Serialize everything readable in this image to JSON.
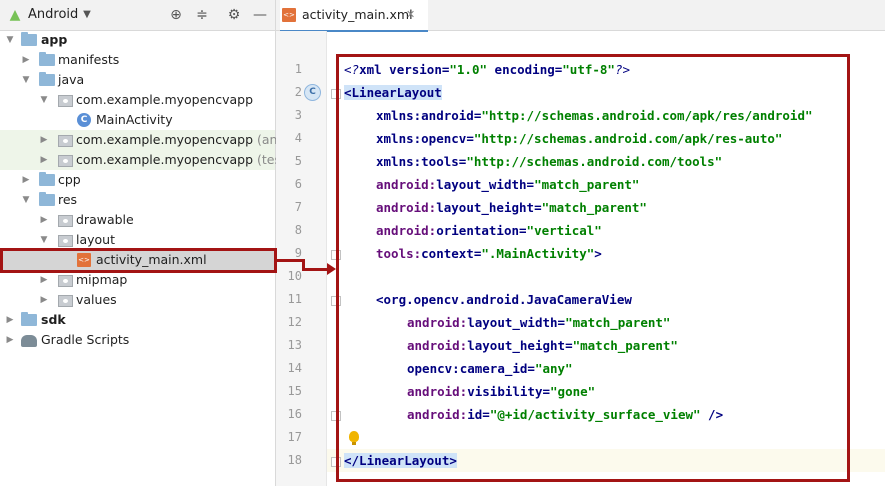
{
  "panel": {
    "title": "Android",
    "dropdown_icon": "chevron-down-icon",
    "toolbar_icons": [
      "target-icon",
      "collapse-icon",
      "gear-icon",
      "minimize-icon"
    ]
  },
  "tree": [
    {
      "label": "app",
      "suffix": ""
    },
    {
      "label": "manifests",
      "suffix": ""
    },
    {
      "label": "java",
      "suffix": ""
    },
    {
      "label": "com.example.myopencvapp",
      "suffix": ""
    },
    {
      "label": "MainActivity",
      "suffix": ""
    },
    {
      "label": "com.example.myopencvapp",
      "suffix": " (androic"
    },
    {
      "label": "com.example.myopencvapp",
      "suffix": " (test)"
    },
    {
      "label": "cpp",
      "suffix": ""
    },
    {
      "label": "res",
      "suffix": ""
    },
    {
      "label": "drawable",
      "suffix": ""
    },
    {
      "label": "layout",
      "suffix": ""
    },
    {
      "label": "activity_main.xml",
      "suffix": ""
    },
    {
      "label": "mipmap",
      "suffix": ""
    },
    {
      "label": "values",
      "suffix": ""
    },
    {
      "label": "sdk",
      "suffix": ""
    },
    {
      "label": "Gradle Scripts",
      "suffix": ""
    }
  ],
  "editor": {
    "tab_label": "activity_main.xml",
    "tab_close": "✕",
    "line_numbers": [
      "1",
      "2",
      "3",
      "4",
      "5",
      "6",
      "7",
      "8",
      "9",
      "10",
      "11",
      "12",
      "13",
      "14",
      "15",
      "16",
      "17",
      "18"
    ],
    "gutter_marker": "C",
    "lines": {
      "l1": {
        "open": "<?",
        "tagname": "xml",
        "a1": " version=",
        "v1": "\"1.0\"",
        "a2": " encoding=",
        "v2": "\"utf-8\"",
        "close": "?>"
      },
      "l2": {
        "text": "<LinearLayout"
      },
      "l3": {
        "ns": "xmlns:",
        "attr": "android",
        "eq": "=",
        "val": "\"http://schemas.android.com/apk/res/android\""
      },
      "l4": {
        "ns": "xmlns:",
        "attr": "opencv",
        "eq": "=",
        "val": "\"http://schemas.android.com/apk/res-auto\""
      },
      "l5": {
        "ns": "xmlns:",
        "attr": "tools",
        "eq": "=",
        "val": "\"http://schemas.android.com/tools\""
      },
      "l6": {
        "ns": "android:",
        "attr": "layout_width",
        "eq": "=",
        "val": "\"match_parent\""
      },
      "l7": {
        "ns": "android:",
        "attr": "layout_height",
        "eq": "=",
        "val": "\"match_parent\""
      },
      "l8": {
        "ns": "android:",
        "attr": "orientation",
        "eq": "=",
        "val": "\"vertical\""
      },
      "l9": {
        "ns": "tools:",
        "attr": "context",
        "eq": "=",
        "val": "\".MainActivity\"",
        "end": ">"
      },
      "l11": {
        "text": "<org.opencv.android.JavaCameraView"
      },
      "l12": {
        "ns": "android:",
        "attr": "layout_width",
        "eq": "=",
        "val": "\"match_parent\""
      },
      "l13": {
        "ns": "android:",
        "attr": "layout_height",
        "eq": "=",
        "val": "\"match_parent\""
      },
      "l14": {
        "ns": "opencv:",
        "attr": "camera_id",
        "eq": "=",
        "val": "\"any\""
      },
      "l15": {
        "ns": "android:",
        "attr": "visibility",
        "eq": "=",
        "val": "\"gone\""
      },
      "l16": {
        "ns": "android:",
        "attr": "id",
        "eq": "=",
        "val": "\"@+id/activity_surface_view\"",
        "end": " />"
      },
      "l18": {
        "text": "</LinearLayout>"
      }
    }
  },
  "colors": {
    "annotation": "#a31414",
    "tag": "#000080",
    "value": "#008000",
    "namespace": "#660e7a"
  }
}
